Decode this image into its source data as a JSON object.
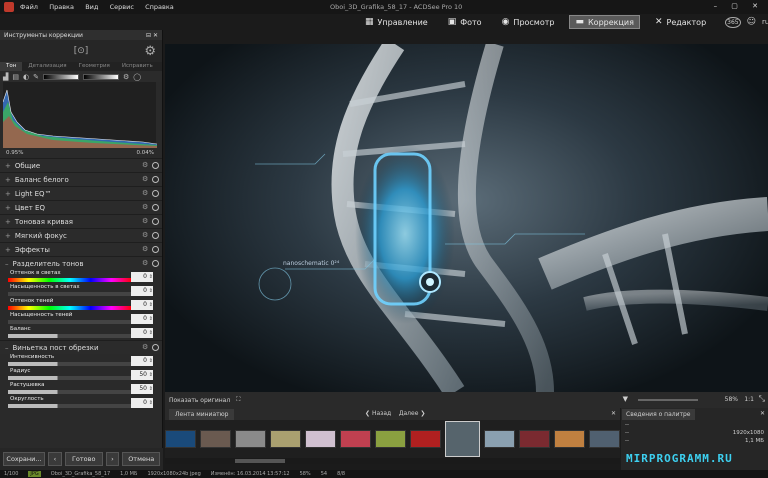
{
  "app": {
    "window_title": "Oboi_3D_Grafika_58_17 - ACDSee Pro 10",
    "menu": [
      "Файл",
      "Правка",
      "Вид",
      "Сервис",
      "Справка"
    ],
    "window_controls": "–  ▢  ✕"
  },
  "modes": [
    {
      "label": "Управление",
      "icon": "grid-icon",
      "glyph": "▦",
      "active": false
    },
    {
      "label": "Фото",
      "icon": "photo-icon",
      "glyph": "▣",
      "active": false
    },
    {
      "label": "Просмотр",
      "icon": "eye-icon",
      "glyph": "◉",
      "active": false
    },
    {
      "label": "Коррекция",
      "icon": "develop-icon",
      "glyph": "▬",
      "active": true
    },
    {
      "label": "Редактор",
      "icon": "edit-icon",
      "glyph": "✕",
      "active": false
    }
  ],
  "mode_extras": [
    "365",
    "☺",
    "ru"
  ],
  "left_panel": {
    "title": "Инструменты коррекции",
    "tabs": [
      "Тон",
      "Детализация",
      "Геометрия",
      "Исправить"
    ],
    "active_tab": 0,
    "histogram": {
      "left_value": "0.95%",
      "right_value": "0.04%"
    },
    "sections": [
      {
        "label": "Общие",
        "expanded": false
      },
      {
        "label": "Баланс белого",
        "expanded": false
      },
      {
        "label": "Light EQ™",
        "expanded": false
      },
      {
        "label": "Цвет EQ",
        "expanded": false
      },
      {
        "label": "Тоновая кривая",
        "expanded": false
      },
      {
        "label": "Мягкий фокус",
        "expanded": false
      },
      {
        "label": "Эффекты",
        "expanded": false
      },
      {
        "label": "Разделитель тонов",
        "expanded": true
      }
    ],
    "split_tone": [
      {
        "label": "Оттенок в светах",
        "value": "0",
        "bar": "rainbow"
      },
      {
        "label": "Насыщенность в светах",
        "value": "0",
        "bar": "plain"
      },
      {
        "label": "Оттенок теней",
        "value": "0",
        "bar": "rainbow"
      },
      {
        "label": "Насыщенность теней",
        "value": "0",
        "bar": "plain"
      },
      {
        "label": "Баланс",
        "value": "0",
        "bar": "plain"
      }
    ],
    "vignette_section": "Виньетка пост обрезки",
    "vignette": [
      {
        "label": "Интенсивность",
        "value": "0"
      },
      {
        "label": "Радиус",
        "value": "50"
      },
      {
        "label": "Растушевка",
        "value": "50"
      },
      {
        "label": "Округлость",
        "value": "0"
      }
    ],
    "buttons": {
      "save": "Сохрани...",
      "done": "Готово",
      "cancel": "Отмена"
    }
  },
  "viewer": {
    "overlay_text": "nanoschematic 0²⁴",
    "show_original": "Показать оригинал",
    "zoom": "58%",
    "ratio": "1:1"
  },
  "filmstrip": {
    "tab": "Лента миниатюр",
    "back": "Назад",
    "forward": "Далее",
    "thumb_colors": [
      "#1a4a7a",
      "#6a5a50",
      "#8a8a8a",
      "#aaa070",
      "#d0c0d0",
      "#c04050",
      "#8aa040",
      "#b02020",
      "#56646c",
      "#8aa0b0",
      "#7a2a30",
      "#c08040",
      "#506070"
    ]
  },
  "info_panel": {
    "tab": "Сведения о палитре",
    "rows": [
      [
        "--",
        ""
      ],
      [
        "--",
        "1920x1080"
      ],
      [
        "--",
        "1,1 МБ"
      ]
    ]
  },
  "watermark": "MIRPROGRAMM.RU",
  "status_bar": [
    "1/100",
    "JPG",
    "Oboi_3D_Grafika_58_17",
    "1,0 МБ",
    "1920x1080x24b jpeg",
    "Изменён: 16.03.2014 13:57:12",
    "58%",
    "54",
    "8/8"
  ]
}
